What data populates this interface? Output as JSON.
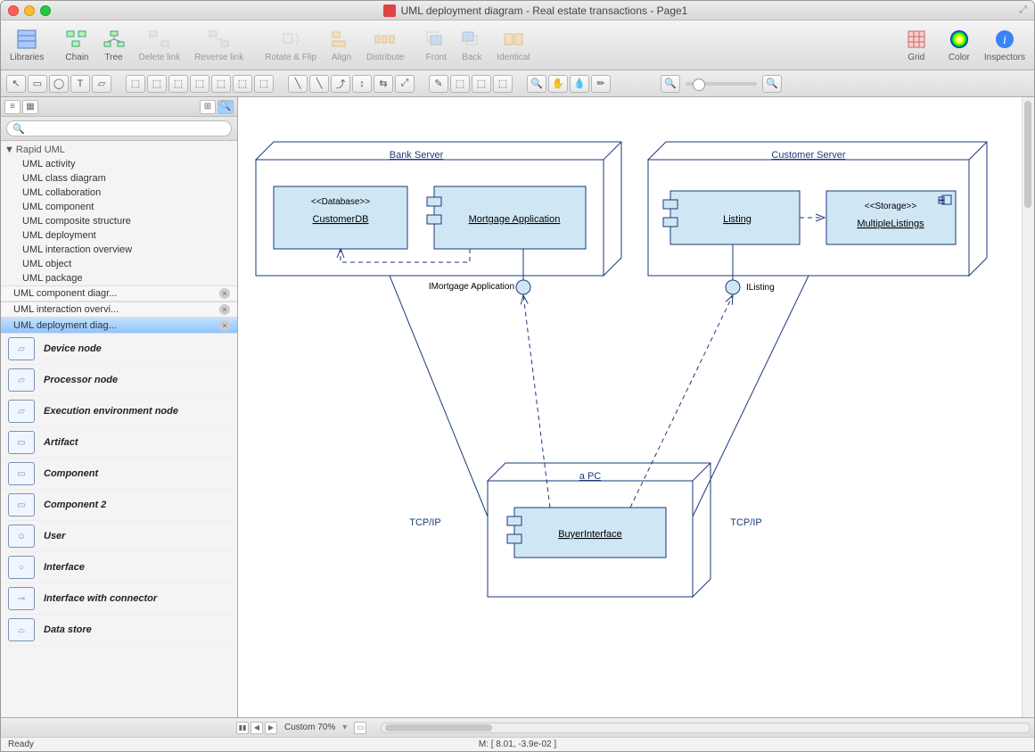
{
  "window": {
    "title": "UML deployment diagram - Real estate transactions - Page1"
  },
  "toolbar": {
    "libraries": "Libraries",
    "chain": "Chain",
    "tree": "Tree",
    "delete_link": "Delete link",
    "reverse_link": "Reverse link",
    "rotate_flip": "Rotate & Flip",
    "align": "Align",
    "distribute": "Distribute",
    "front": "Front",
    "back": "Back",
    "identical": "Identical",
    "grid": "Grid",
    "color": "Color",
    "inspectors": "Inspectors"
  },
  "tree": {
    "root": "Rapid UML",
    "items": [
      "UML activity",
      "UML class diagram",
      "UML collaboration",
      "UML component",
      "UML composite structure",
      "UML deployment",
      "UML interaction overview",
      "UML object",
      "UML package"
    ]
  },
  "tabs": [
    {
      "label": "UML component diagr..."
    },
    {
      "label": "UML interaction overvi..."
    },
    {
      "label": "UML deployment diag...",
      "active": true
    }
  ],
  "shapes": [
    "Device node",
    "Processor node",
    "Execution environment node",
    "Artifact",
    "Component",
    "Component 2",
    "User",
    "Interface",
    "Interface with connector",
    "Data store"
  ],
  "diagram": {
    "nodes": {
      "bank": {
        "title": "Bank Server"
      },
      "customer": {
        "title": "Customer Server"
      },
      "pc": {
        "title": "a PC"
      }
    },
    "components": {
      "customerdb": {
        "stereotype": "<<Database>>",
        "name": "CustomerDB"
      },
      "mortgage": {
        "name": "Mortgage Application"
      },
      "listing": {
        "name": "Listing"
      },
      "multiple": {
        "stereotype": "<<Storage>>",
        "name": "MultipleListings"
      },
      "buyer": {
        "name": "BuyerInterface"
      }
    },
    "interfaces": {
      "imortgage": "IMortgage Application",
      "ilisting": "IListing"
    },
    "labels": {
      "tcpip_left": "TCP/IP",
      "tcpip_right": "TCP/IP"
    }
  },
  "footer": {
    "zoom": "Custom 70%",
    "status_ready": "Ready",
    "mouse": "M: [ 8.01, -3.9e-02 ]"
  }
}
